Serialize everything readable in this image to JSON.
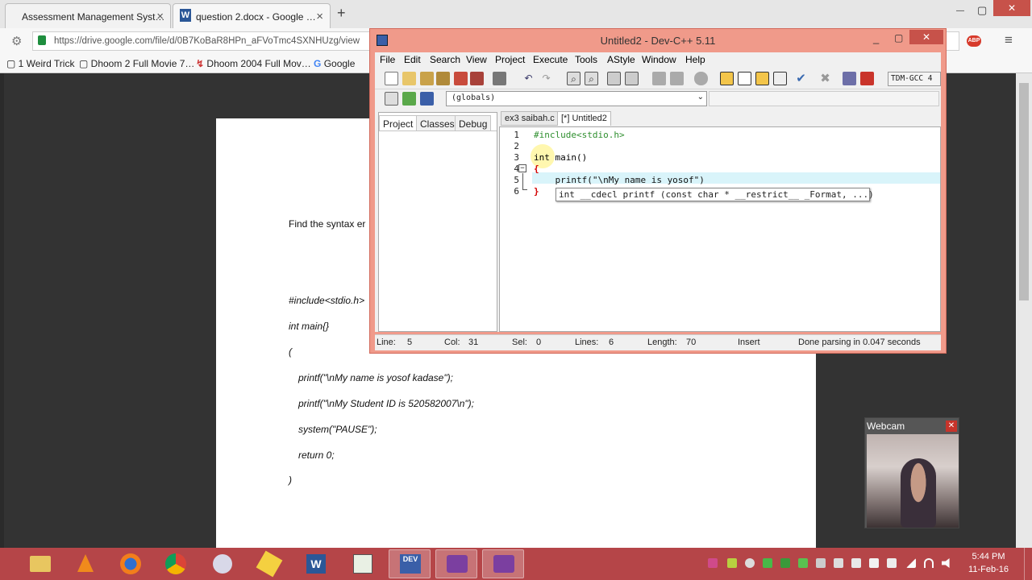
{
  "browser": {
    "tabs": [
      {
        "title": "Assessment Management Syst…"
      },
      {
        "title": "question 2.docx - Google …"
      }
    ],
    "new_tab": "+",
    "url": "https://drive.google.com/file/d/0B7KoBaR8HPn_aFVoTmc4SXNHUzg/view",
    "bookmarks": [
      "1 Weird Trick",
      "Dhoom 2 Full Movie 7…",
      "Dhoom 2004 Full Mov…",
      "Google"
    ],
    "window_controls": {
      "minimize": "—",
      "maximize": "▢",
      "close": "✕"
    },
    "abp": "ABP"
  },
  "document": {
    "lines": [
      "Find the syntax er",
      "#include<stdio.h>",
      "int main{}",
      "(",
      "printf(\"\\nMy name is yosof kadase\");",
      "printf(\"\\nMy Student ID is 520582007\\n\");",
      "system(\"PAUSE\");",
      "return 0;",
      ")"
    ]
  },
  "devcpp": {
    "title": "Untitled2 - Dev-C++ 5.11",
    "menu": [
      "File",
      "Edit",
      "Search",
      "View",
      "Project",
      "Execute",
      "Tools",
      "AStyle",
      "Window",
      "Help"
    ],
    "compiler": "TDM-GCC 4",
    "globals": "(globals)",
    "panel_tabs": [
      "Project",
      "Classes",
      "Debug"
    ],
    "editor_tabs": [
      "ex3 saibah.c",
      "[*] Untitled2"
    ],
    "code_lines": [
      {
        "n": "1",
        "text": "#include<stdio.h>"
      },
      {
        "n": "2",
        "text": ""
      },
      {
        "n": "3",
        "text": "int main()"
      },
      {
        "n": "4",
        "text": "{"
      },
      {
        "n": "5",
        "text": "    printf(\"\\nMy name is yosof\")"
      },
      {
        "n": "6",
        "text": "}"
      }
    ],
    "tooltip": "int __cdecl printf (const char * __restrict__ _Format, ...)",
    "status": {
      "line_label": "Line:",
      "line": "5",
      "col_label": "Col:",
      "col": "31",
      "sel_label": "Sel:",
      "sel": "0",
      "lines_label": "Lines:",
      "lines": "6",
      "length_label": "Length:",
      "length": "70",
      "mode": "Insert",
      "message": "Done parsing in 0.047 seconds"
    }
  },
  "webcam": {
    "title": "Webcam",
    "close": "✕"
  },
  "taskbar": {
    "time": "5:44 PM",
    "date": "11-Feb-16",
    "accent": "#b54548"
  }
}
